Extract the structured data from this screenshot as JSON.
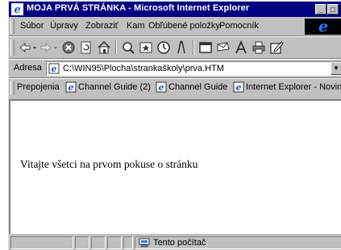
{
  "window": {
    "title": "MOJA PRVÁ STRÁNKA - Microsoft Internet Explorer",
    "controls": [
      "minimize",
      "maximize"
    ]
  },
  "menu": {
    "items": [
      "Súbor",
      "Úpravy",
      "Zobraziť",
      "Kam",
      "Obľúbené položky",
      "Pomocník"
    ],
    "logo": "e"
  },
  "toolbar": {
    "buttons": [
      "back",
      "forward",
      "stop",
      "refresh",
      "home",
      "search",
      "favorites",
      "history",
      "channels",
      "fullscreen",
      "mail",
      "print",
      "edit"
    ]
  },
  "address": {
    "label": "Adresa",
    "url": "C:\\WIN95\\Plocha\\strankaškoly\\prva.HTM"
  },
  "links": {
    "label": "Prepojenia",
    "items": [
      "Channel Guide (2)",
      "Channel Guide",
      "Internet Explorer - Novinky"
    ]
  },
  "page": {
    "text": "Vitajte všetci na prvom pokuse o stránku"
  },
  "status": {
    "zone": "Tento počítač"
  },
  "colors": {
    "titlebar": "#000080",
    "chrome": "#c0c0c0",
    "ie_logo": "#2a7bff"
  }
}
